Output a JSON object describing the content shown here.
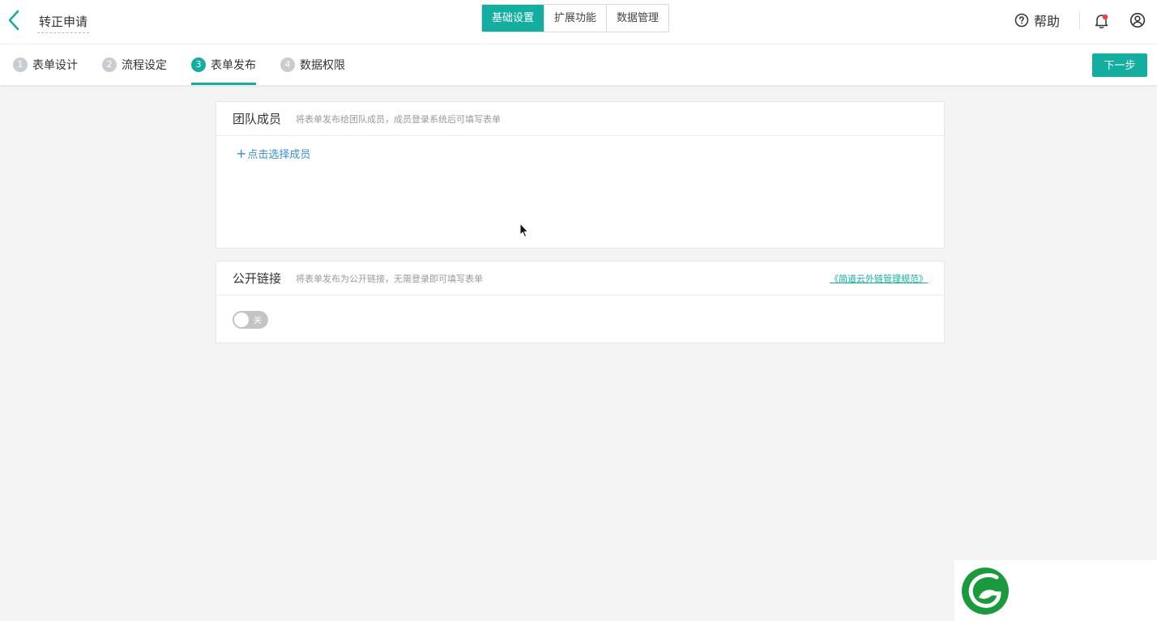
{
  "header": {
    "title": "转正申请",
    "tabs": [
      {
        "label": "基础设置",
        "active": true
      },
      {
        "label": "扩展功能",
        "active": false
      },
      {
        "label": "数据管理",
        "active": false
      }
    ],
    "help_label": "帮助"
  },
  "steps": {
    "items": [
      {
        "num": "1",
        "label": "表单设计",
        "active": false
      },
      {
        "num": "2",
        "label": "流程设定",
        "active": false
      },
      {
        "num": "3",
        "label": "表单发布",
        "active": true
      },
      {
        "num": "4",
        "label": "数据权限",
        "active": false
      }
    ],
    "next_label": "下一步"
  },
  "team": {
    "title": "团队成员",
    "desc": "将表单发布给团队成员，成员登录系统后可填写表单",
    "add_label": "点击选择成员"
  },
  "public_link": {
    "title": "公开链接",
    "desc": "将表单发布为公开链接，无需登录即可填写表单",
    "link_label": "《简道云外链管理规范》",
    "toggle_on": false,
    "toggle_label": "关"
  },
  "colors": {
    "accent": "#13aea0",
    "link_blue": "#3a8fd6",
    "notification_dot": "#f0424a"
  },
  "icons": {
    "back": "chevron-left-icon",
    "help": "question-circle-icon",
    "bell": "bell-icon",
    "user": "user-circle-icon",
    "add": "plus-icon"
  }
}
